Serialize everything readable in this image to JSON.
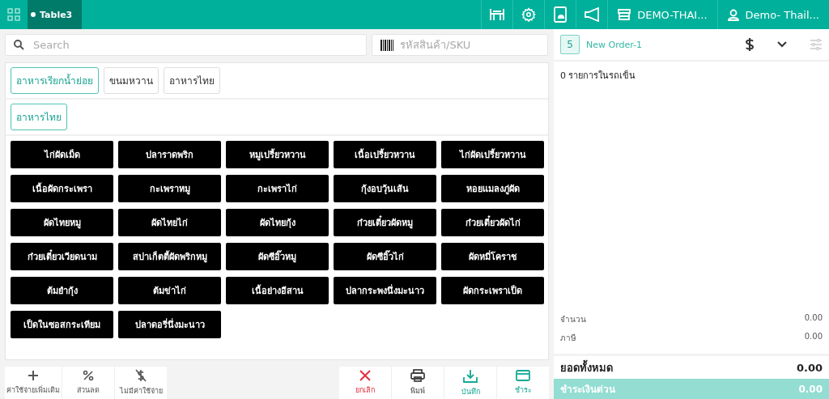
{
  "topbar": {
    "tab": {
      "label": "Table3",
      "selected": true
    },
    "actions": [
      {
        "kind": "table"
      },
      {
        "kind": "settings"
      },
      {
        "kind": "phone"
      },
      {
        "kind": "megaphone"
      }
    ],
    "store": "DEMO-THAI...",
    "user": "Demo- Thail..."
  },
  "search": {
    "placeholder": "Search"
  },
  "sku": {
    "placeholder": "รหัสสินค้า/SKU"
  },
  "categories": [
    {
      "label": "อาหารเรียกน้ำย่อย",
      "selected": true
    },
    {
      "label": "ขนมหวาน",
      "selected": false
    },
    {
      "label": "อาหารไทย",
      "selected": false
    }
  ],
  "subcategories": [
    {
      "label": "อาหารไทย",
      "selected": true
    }
  ],
  "products": [
    "ไก่ผัดเม็ด",
    "ปลาราดพริก",
    "หมูเปรี้ยวหวาน",
    "เนื้อเปรี้ยวหวาน",
    "ไก่ผัดเปรี้ยวหวาน",
    "เนื้อผัดกระเพรา",
    "กะเพราหมู",
    "กะเพราไก่",
    "กุ้งอบวุ้นเส้น",
    "หอยแมลงภู่ผัด",
    "ผัดไทยหมู",
    "ผัดไทยไก่",
    "ผัดไทยกุ้ง",
    "ก๋วยเตี๋ยวผัดหมู",
    "ก๋วยเตี๋ยวผัดไก่",
    "ก๋วยเตี๋ยวเวียดนาม",
    "สปาเก็ตตี้ผัดพริกหมู",
    "ผัดซีอิ๊วหมู",
    "ผัดซีอิ๊วไก่",
    "ผัดหมี่โคราช",
    "ต้มยำกุ้ง",
    "ต้มข่าไก่",
    "เนื้อย่างอีสาน",
    "ปลากระพงนึ่งมะนาว",
    "ผัดกระเพราเป็ด",
    "เป็ดในซอสกระเทียม",
    "ปลาดอรี่นึ่งมะนาว"
  ],
  "footer_left": [
    {
      "kind": "plus",
      "label": "ค่าใช้จ่ายเพิ่มเติม"
    },
    {
      "kind": "percent",
      "label": "ส่วนลด"
    },
    {
      "kind": "nocharge",
      "label": "ไม่มีค่าใช้จ่าย"
    }
  ],
  "footer_right": [
    {
      "kind": "cancel",
      "label": "ยกเลิก"
    },
    {
      "kind": "print",
      "label": "พิมพ์"
    },
    {
      "kind": "save",
      "label": "บันทึก"
    },
    {
      "kind": "pay",
      "label": "ชำระ"
    }
  ],
  "order": {
    "count": "5",
    "name": "New Order-1",
    "cart_summary": "0 รายการในรถเข็น",
    "lines": [
      {
        "label": "จำนวน",
        "value": "0.00"
      },
      {
        "label": "ภาษี",
        "value": "0.00"
      }
    ],
    "total": {
      "label": "ยอดทั้งหมด",
      "value": "0.00"
    },
    "quick_pay": {
      "label": "ชำระเงินด่วน",
      "value": "0.00"
    }
  }
}
